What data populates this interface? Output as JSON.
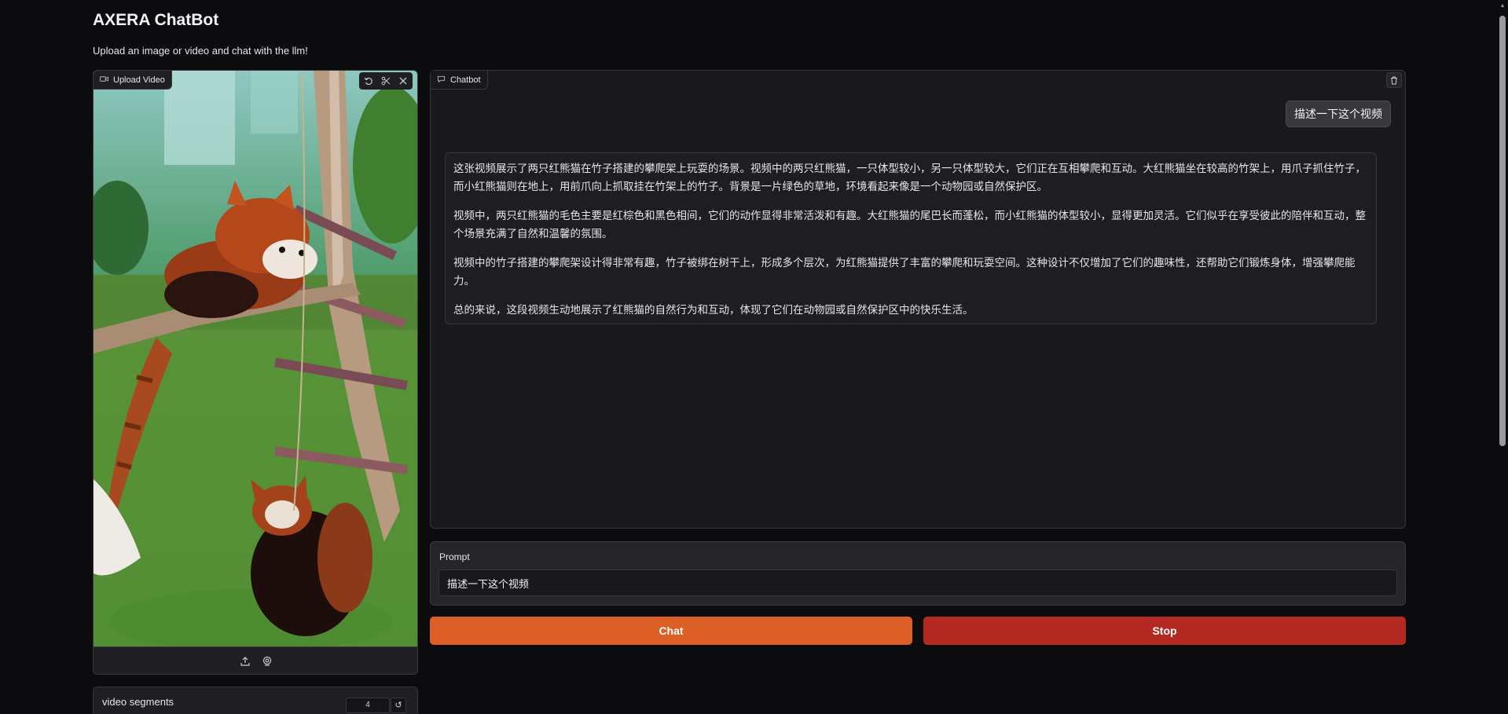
{
  "app": {
    "title": "AXERA ChatBot",
    "subtitle": "Upload an image or video and chat with the llm!"
  },
  "video_panel": {
    "label": "Upload Video",
    "tools": [
      "undo-icon",
      "scissors-icon",
      "close-icon"
    ],
    "bottom_tools": [
      "upload-icon",
      "webcam-icon"
    ]
  },
  "segments": {
    "label": "video segments",
    "value": "4",
    "reset_glyph": "↺"
  },
  "chatbot": {
    "label": "Chatbot",
    "user_message": "描述一下这个视频",
    "bot_paragraphs": [
      "这张视频展示了两只红熊猫在竹子搭建的攀爬架上玩耍的场景。视频中的两只红熊猫，一只体型较小，另一只体型较大，它们正在互相攀爬和互动。大红熊猫坐在较高的竹架上，用爪子抓住竹子，而小红熊猫则在地上，用前爪向上抓取挂在竹架上的竹子。背景是一片绿色的草地，环境看起来像是一个动物园或自然保护区。",
      "视频中，两只红熊猫的毛色主要是红棕色和黑色相间，它们的动作显得非常活泼和有趣。大红熊猫的尾巴长而蓬松，而小红熊猫的体型较小，显得更加灵活。它们似乎在享受彼此的陪伴和互动，整个场景充满了自然和温馨的氛围。",
      "视频中的竹子搭建的攀爬架设计得非常有趣，竹子被绑在树干上，形成多个层次，为红熊猫提供了丰富的攀爬和玩耍空间。这种设计不仅增加了它们的趣味性，还帮助它们锻炼身体，增强攀爬能力。",
      "总的来说，这段视频生动地展示了红熊猫的自然行为和互动，体现了它们在动物园或自然保护区中的快乐生活。"
    ]
  },
  "prompt": {
    "label": "Prompt",
    "value": "描述一下这个视频"
  },
  "buttons": {
    "chat": "Chat",
    "stop": "Stop"
  },
  "colors": {
    "chat_button": "#dc5f25",
    "stop_button": "#b42a22",
    "background": "#0c0c0f"
  }
}
